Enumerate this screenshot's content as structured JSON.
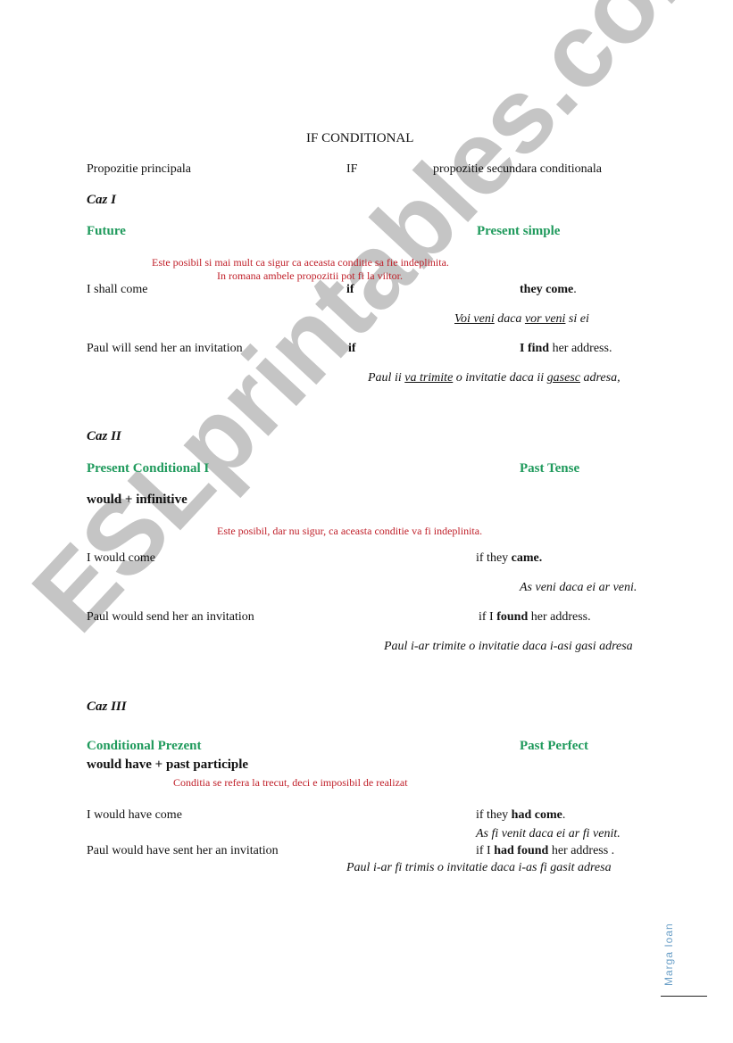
{
  "title": "IF CONDITIONAL",
  "header": {
    "main_clause": "Propozitie principala",
    "if": "IF",
    "sub_clause": "propozitie secundara conditionala"
  },
  "case1": {
    "label": "Caz  I",
    "left_tense": "Future",
    "right_tense": "Present simple",
    "note1": "Este posibil si mai mult ca sigur ca aceasta conditie sa fie indeplinita.",
    "note2": "In romana ambele propozitii pot  fi la viitor.",
    "ex1": {
      "main": "I shall come",
      "if": "if",
      "cond_bold": "they come",
      "cond_rest": ".",
      "tr": [
        "Voi veni",
        " daca ",
        "vor veni",
        " si ei"
      ]
    },
    "ex2": {
      "main": "Paul will send her an invitation",
      "if": "if",
      "cond_bold": "I find",
      "cond_rest": " her address.",
      "tr": [
        "Paul ii ",
        "va trimite",
        " o invitatie daca ii ",
        "gasesc",
        "  adresa,"
      ]
    }
  },
  "case2": {
    "label": "Caz II",
    "left_tense": "Present Conditional  I",
    "right_tense": "Past Tense",
    "formula": "would + infinitive",
    "note": "Este posibil, dar nu sigur, ca aceasta conditie va fi indeplinita.",
    "ex1": {
      "main": "I would come",
      "cond_pre": "if they ",
      "cond_bold": "came.",
      "tr": "As veni daca ei ar veni."
    },
    "ex2": {
      "main": "Paul would send her an invitation",
      "cond_pre": "if I ",
      "cond_bold": "found",
      "cond_rest": " her address.",
      "tr": "Paul i-ar trimite o invitatie daca i-asi gasi adresa"
    }
  },
  "case3": {
    "label": "Caz III",
    "left_tense": "Conditional  Prezent",
    "right_tense": "Past Perfect",
    "formula": "would have + past participle",
    "note": "Conditia se refera la trecut, deci e imposibil de realizat",
    "ex1": {
      "main": "I would have come",
      "cond_pre": "if they  ",
      "cond_bold": "had come",
      "cond_rest": ".",
      "tr": "As fi venit daca ei ar fi venit."
    },
    "ex2": {
      "main": "Paul would have sent her an invitation",
      "cond_pre": "if I ",
      "cond_bold": "had found",
      "cond_rest": " her address .",
      "tr": "Paul i-ar fi trimis o invitatie daca i-as fi gasit adresa"
    }
  },
  "watermark": "ESLprintables.com",
  "author": "Marga   Ioan"
}
